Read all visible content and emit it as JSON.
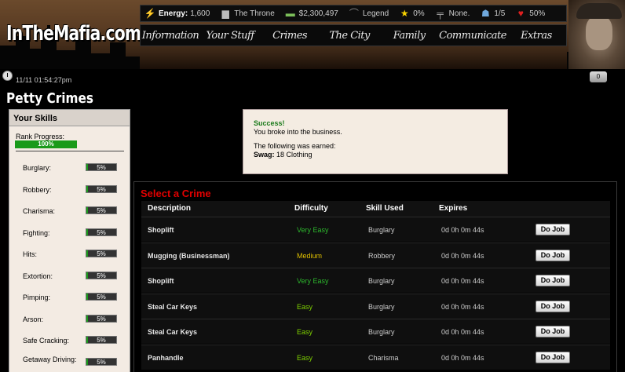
{
  "header": {
    "logo": "InTheMafia.com",
    "stats": [
      {
        "icon": "lightning-icon",
        "label": "Energy:",
        "value": "1,600"
      },
      {
        "icon": "building-icon",
        "label": "",
        "value": "The Throne"
      },
      {
        "icon": "money-icon",
        "label": "",
        "value": "$2,300,497"
      },
      {
        "icon": "hat-icon",
        "label": "",
        "value": "Legend"
      },
      {
        "icon": "star-icon",
        "label": "",
        "value": "0%"
      },
      {
        "icon": "gun-icon",
        "label": "",
        "value": "None."
      },
      {
        "icon": "crew-icon",
        "label": "",
        "value": "1/5"
      },
      {
        "icon": "heart-icon",
        "label": "",
        "value": "50%"
      }
    ],
    "nav": [
      "Information",
      "Your Stuff",
      "Crimes",
      "The City",
      "Family",
      "Communicate",
      "Extras"
    ]
  },
  "timestamp": "11/11 01:54:27pm",
  "messages_count": "0",
  "page_title": "Petty Crimes",
  "skills": {
    "heading": "Your Skills",
    "rank_label": "Rank Progress:",
    "rank_value": "100%",
    "rank_fraction": 1.0,
    "items": [
      {
        "name": "Burglary:",
        "pct": "5%",
        "fraction": 0.05
      },
      {
        "name": "Robbery:",
        "pct": "5%",
        "fraction": 0.05
      },
      {
        "name": "Charisma:",
        "pct": "5%",
        "fraction": 0.05
      },
      {
        "name": "Fighting:",
        "pct": "5%",
        "fraction": 0.05
      },
      {
        "name": "Hits:",
        "pct": "5%",
        "fraction": 0.05
      },
      {
        "name": "Extortion:",
        "pct": "5%",
        "fraction": 0.05
      },
      {
        "name": "Pimping:",
        "pct": "5%",
        "fraction": 0.05
      },
      {
        "name": "Arson:",
        "pct": "5%",
        "fraction": 0.05
      },
      {
        "name": "Safe Cracking:",
        "pct": "5%",
        "fraction": 0.05
      },
      {
        "name": "Getaway Driving:",
        "pct": "5%",
        "fraction": 0.05
      }
    ]
  },
  "result": {
    "title": "Success!",
    "message": "You broke into the business.",
    "earned_label": "The following was earned:",
    "swag_label": "Swag:",
    "swag_value": "18 Clothing"
  },
  "crimes": {
    "heading": "Select a Crime",
    "columns": [
      "Description",
      "Difficulty",
      "Skill Used",
      "Expires"
    ],
    "button_label": "Do Job",
    "rows": [
      {
        "description": "Shoplift",
        "difficulty": "Very Easy",
        "skill": "Burglary",
        "expires": "0d 0h 0m 44s"
      },
      {
        "description": "Mugging (Businessman)",
        "difficulty": "Medium",
        "skill": "Robbery",
        "expires": "0d 0h 0m 44s"
      },
      {
        "description": "Shoplift",
        "difficulty": "Very Easy",
        "skill": "Burglary",
        "expires": "0d 0h 0m 44s"
      },
      {
        "description": "Steal Car Keys",
        "difficulty": "Easy",
        "skill": "Burglary",
        "expires": "0d 0h 0m 44s"
      },
      {
        "description": "Steal Car Keys",
        "difficulty": "Easy",
        "skill": "Burglary",
        "expires": "0d 0h 0m 44s"
      },
      {
        "description": "Panhandle",
        "difficulty": "Easy",
        "skill": "Charisma",
        "expires": "0d 0h 0m 44s"
      }
    ]
  },
  "colors": {
    "accent_red": "#e10000",
    "success_green": "#1a7a1a",
    "bar_green": "#1a9a1a",
    "very_easy": "#2db82d",
    "easy": "#7ed000",
    "medium": "#e0c000"
  }
}
